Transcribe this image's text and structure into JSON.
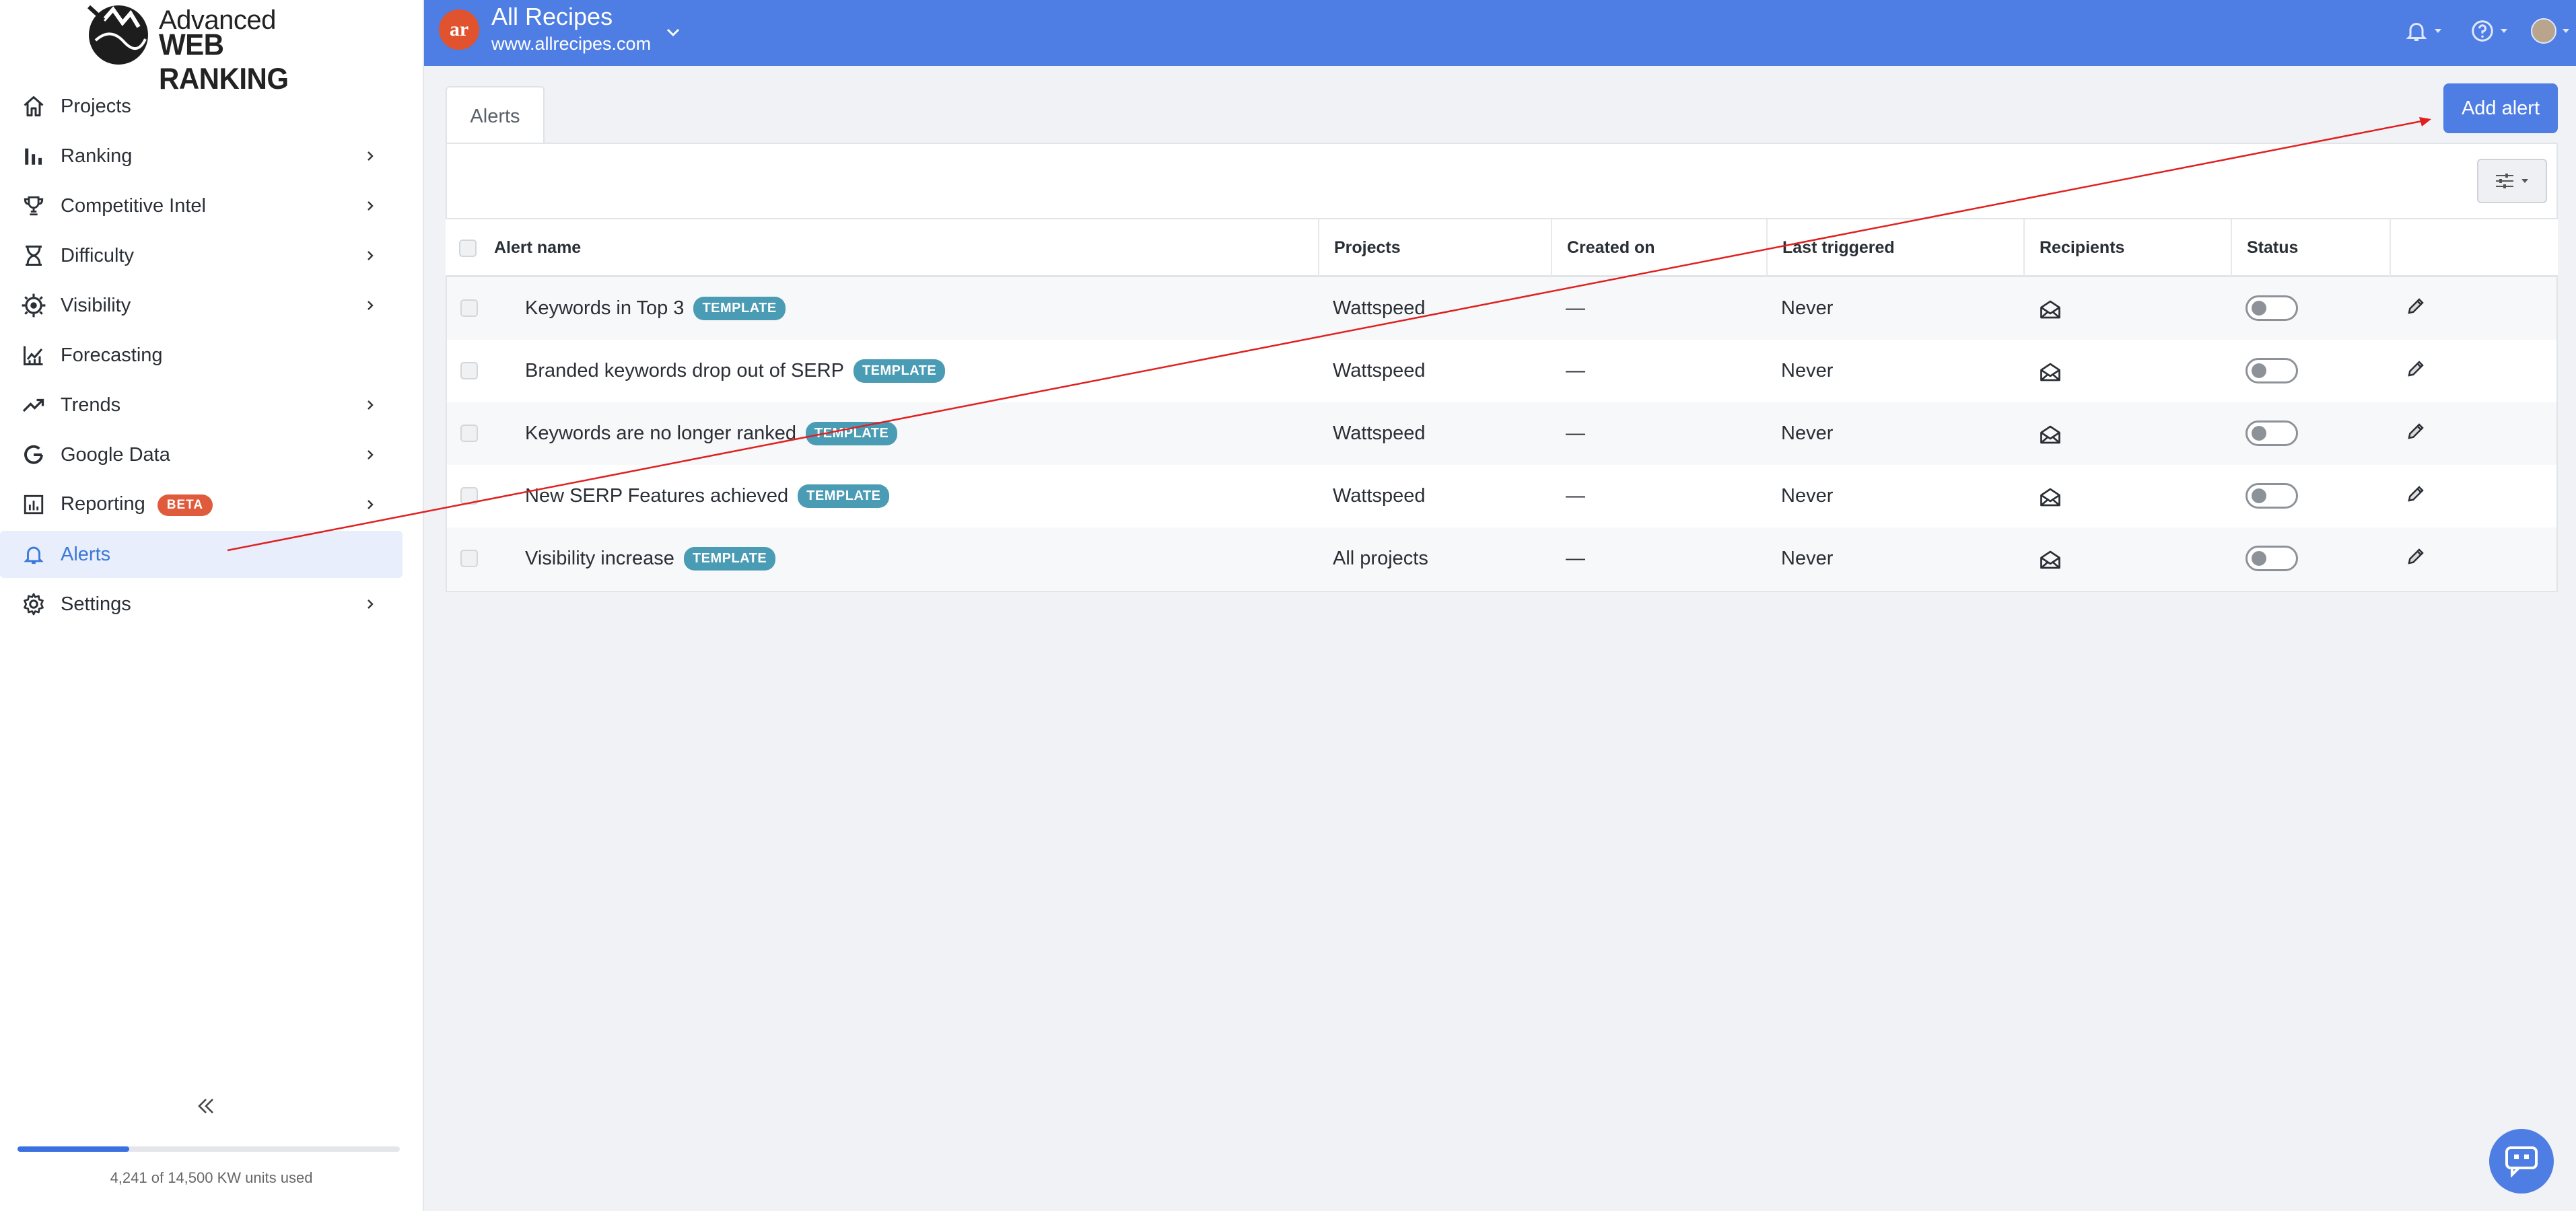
{
  "brand": {
    "line1": "Advanced",
    "line2": "WEB RANKING"
  },
  "sidebar": {
    "items": [
      {
        "label": "Projects",
        "icon": "home-icon",
        "chevron": false
      },
      {
        "label": "Ranking",
        "icon": "bar-chart-icon",
        "chevron": true
      },
      {
        "label": "Competitive Intel",
        "icon": "trophy-icon",
        "chevron": true
      },
      {
        "label": "Difficulty",
        "icon": "hourglass-icon",
        "chevron": true
      },
      {
        "label": "Visibility",
        "icon": "visibility-gear-icon",
        "chevron": true
      },
      {
        "label": "Forecasting",
        "icon": "forecast-chart-icon",
        "chevron": false
      },
      {
        "label": "Trends",
        "icon": "trend-up-icon",
        "chevron": true
      },
      {
        "label": "Google Data",
        "icon": "google-icon",
        "chevron": true
      },
      {
        "label": "Reporting",
        "badge": "BETA",
        "icon": "report-icon",
        "chevron": true
      },
      {
        "label": "Alerts",
        "icon": "bell-icon",
        "chevron": false,
        "active": true
      },
      {
        "label": "Settings",
        "icon": "gear-icon",
        "chevron": true
      }
    ],
    "usage": {
      "text": "4,241 of 14,500 KW units used",
      "fraction": 0.2925
    }
  },
  "header": {
    "project_name": "All Recipes",
    "project_url": "www.allrecipes.com",
    "project_logo_text": "ar"
  },
  "main": {
    "tab": "Alerts",
    "add_button": "Add alert",
    "columns": [
      "Alert name",
      "Projects",
      "Created on",
      "Last triggered",
      "Recipients",
      "Status"
    ],
    "rows": [
      {
        "name": "Keywords in Top 3",
        "badge": "TEMPLATE",
        "project": "Wattspeed",
        "created": "—",
        "triggered": "Never"
      },
      {
        "name": "Branded keywords drop out of SERP",
        "badge": "TEMPLATE",
        "project": "Wattspeed",
        "created": "—",
        "triggered": "Never"
      },
      {
        "name": "Keywords are no longer ranked",
        "badge": "TEMPLATE",
        "project": "Wattspeed",
        "created": "—",
        "triggered": "Never"
      },
      {
        "name": "New SERP Features achieved",
        "badge": "TEMPLATE",
        "project": "Wattspeed",
        "created": "—",
        "triggered": "Never"
      },
      {
        "name": "Visibility increase",
        "badge": "TEMPLATE",
        "project": "All projects",
        "created": "—",
        "triggered": "Never"
      }
    ]
  },
  "colors": {
    "accent": "#4e7de3",
    "template_badge": "#4a9bb4",
    "beta_badge": "#e05a3c",
    "annotation": "#e02020"
  }
}
